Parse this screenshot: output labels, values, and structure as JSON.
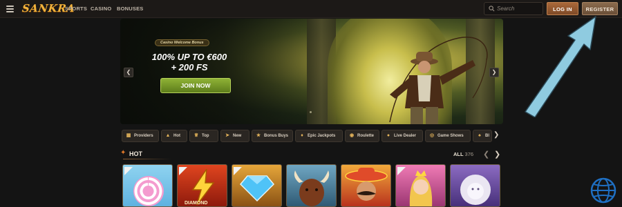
{
  "header": {
    "logo": "SANKRA",
    "nav": [
      "SPORTS",
      "CASINO",
      "BONUSES"
    ],
    "search_placeholder": "Search",
    "login_label": "LOG IN",
    "register_label": "REGISTER"
  },
  "banner": {
    "tag": "Casino Welcome Bonus",
    "title_line1": "100% UP TO €600",
    "title_line2": "+ 200 FS",
    "cta": "JOIN NOW",
    "prev_icon": "chevron-left-icon",
    "next_icon": "chevron-right-icon"
  },
  "categories": [
    {
      "label": "Providers",
      "icon": "providers-icon"
    },
    {
      "label": "Hot",
      "icon": "fire-icon"
    },
    {
      "label": "Top",
      "icon": "crown-icon"
    },
    {
      "label": "New",
      "icon": "new-icon"
    },
    {
      "label": "Bonus Buys",
      "icon": "star-icon"
    },
    {
      "label": "Epic Jackpots",
      "icon": "jackpot-icon"
    },
    {
      "label": "Roulette",
      "icon": "roulette-icon"
    },
    {
      "label": "Live Dealer",
      "icon": "live-dealer-icon"
    },
    {
      "label": "Game Shows",
      "icon": "game-shows-icon"
    },
    {
      "label": "Bl",
      "icon": "blackjack-icon"
    }
  ],
  "hot": {
    "title": "HOT",
    "all_label": "ALL",
    "count": "376"
  },
  "games": [
    {
      "name": "candy-swirl",
      "caption": ""
    },
    {
      "name": "lightning-diamond",
      "caption": "DIAMOND"
    },
    {
      "name": "blue-diamond",
      "caption": ""
    },
    {
      "name": "buffalo",
      "caption": ""
    },
    {
      "name": "mexican-mustache",
      "caption": ""
    },
    {
      "name": "golden-princess",
      "caption": ""
    },
    {
      "name": "white-lion",
      "caption": ""
    }
  ],
  "colors": {
    "accent": "#f2b33b",
    "login_bg": "#a9683a",
    "join_bg": "#8fb236",
    "annotation_arrow": "#8fcbe0",
    "globe": "#1f6fc2"
  }
}
